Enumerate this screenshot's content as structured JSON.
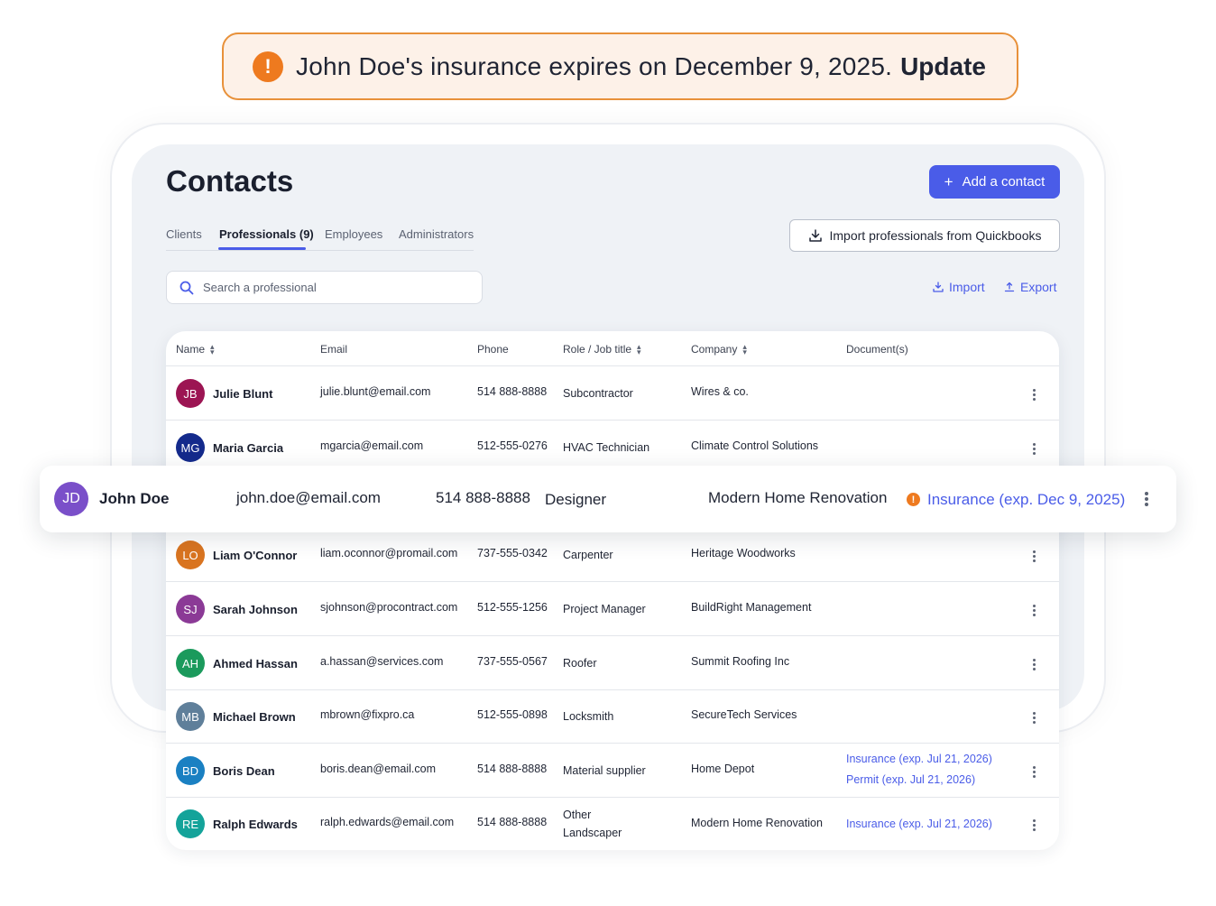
{
  "banner": {
    "icon": "warning-icon",
    "message": "John Doe's insurance expires on December 9, 2025.",
    "action": "Update"
  },
  "header": {
    "title": "Contacts",
    "add_button": "Add a contact"
  },
  "tabs": [
    {
      "label": "Clients"
    },
    {
      "label": "Professionals (9)"
    },
    {
      "label": "Employees"
    },
    {
      "label": "Administrators"
    }
  ],
  "actions": {
    "quickbooks": "Import professionals from Quickbooks",
    "import": "Import",
    "export": "Export"
  },
  "search": {
    "placeholder": "Search a professional"
  },
  "table": {
    "columns": [
      "Name",
      "Email",
      "Phone",
      "Role / Job title",
      "Company",
      "Document(s)"
    ],
    "rows": [
      {
        "initials": "JB",
        "color": "#9c1553",
        "name": "Julie Blunt",
        "email": "julie.blunt@email.com",
        "phone": "514 888-8888",
        "role": "Subcontractor",
        "role2": "",
        "company": "Wires & co.",
        "doc1": "",
        "doc2": ""
      },
      {
        "initials": "MG",
        "color": "#142a8c",
        "name": "Maria Garcia",
        "email": "mgarcia@email.com",
        "phone": "512-555-0276",
        "role": "HVAC Technician",
        "role2": "",
        "company": "Climate Control Solutions",
        "doc1": "",
        "doc2": ""
      },
      {
        "initials": "LO",
        "color": "#d97420",
        "name": "Liam O'Connor",
        "email": "liam.oconnor@promail.com",
        "phone": "737-555-0342",
        "role": "Carpenter",
        "role2": "",
        "company": "Heritage Woodworks",
        "doc1": "",
        "doc2": ""
      },
      {
        "initials": "SJ",
        "color": "#8b3a96",
        "name": "Sarah Johnson",
        "email": "sjohnson@procontract.com",
        "phone": "512-555-1256",
        "role": "Project Manager",
        "role2": "",
        "company": "BuildRight Management",
        "doc1": "",
        "doc2": ""
      },
      {
        "initials": "AH",
        "color": "#1b9a5c",
        "name": "Ahmed Hassan",
        "email": "a.hassan@services.com",
        "phone": "737-555-0567",
        "role": "Roofer",
        "role2": "",
        "company": "Summit Roofing Inc",
        "doc1": "",
        "doc2": ""
      },
      {
        "initials": "MB",
        "color": "#5f7f9a",
        "name": "Michael Brown",
        "email": "mbrown@fixpro.ca",
        "phone": "512-555-0898",
        "role": "Locksmith",
        "role2": "",
        "company": "SecureTech Services",
        "doc1": "",
        "doc2": ""
      },
      {
        "initials": "BD",
        "color": "#1a80c2",
        "name": "Boris Dean",
        "email": "boris.dean@email.com",
        "phone": "514 888-8888",
        "role": "Material supplier",
        "role2": "",
        "company": "Home Depot",
        "doc1": "Insurance (exp. Jul 21, 2026)",
        "doc2": "Permit (exp. Jul 21, 2026)"
      },
      {
        "initials": "RE",
        "color": "#14a39a",
        "name": "Ralph Edwards",
        "email": "ralph.edwards@email.com",
        "phone": "514 888-8888",
        "role": "Other",
        "role2": "Landscaper",
        "company": "Modern Home Renovation",
        "doc1": "Insurance (exp. Jul 21, 2026)",
        "doc2": ""
      }
    ]
  },
  "highlight": {
    "initials": "JD",
    "color": "#7a4fc9",
    "name": "John Doe",
    "email": "john.doe@email.com",
    "phone": "514 888-8888",
    "role": "Designer",
    "company": "Modern Home Renovation",
    "doc": "Insurance (exp. Dec 9, 2025)",
    "doc_color": "#4a5ce8",
    "warn_color": "#ee7a1f"
  }
}
